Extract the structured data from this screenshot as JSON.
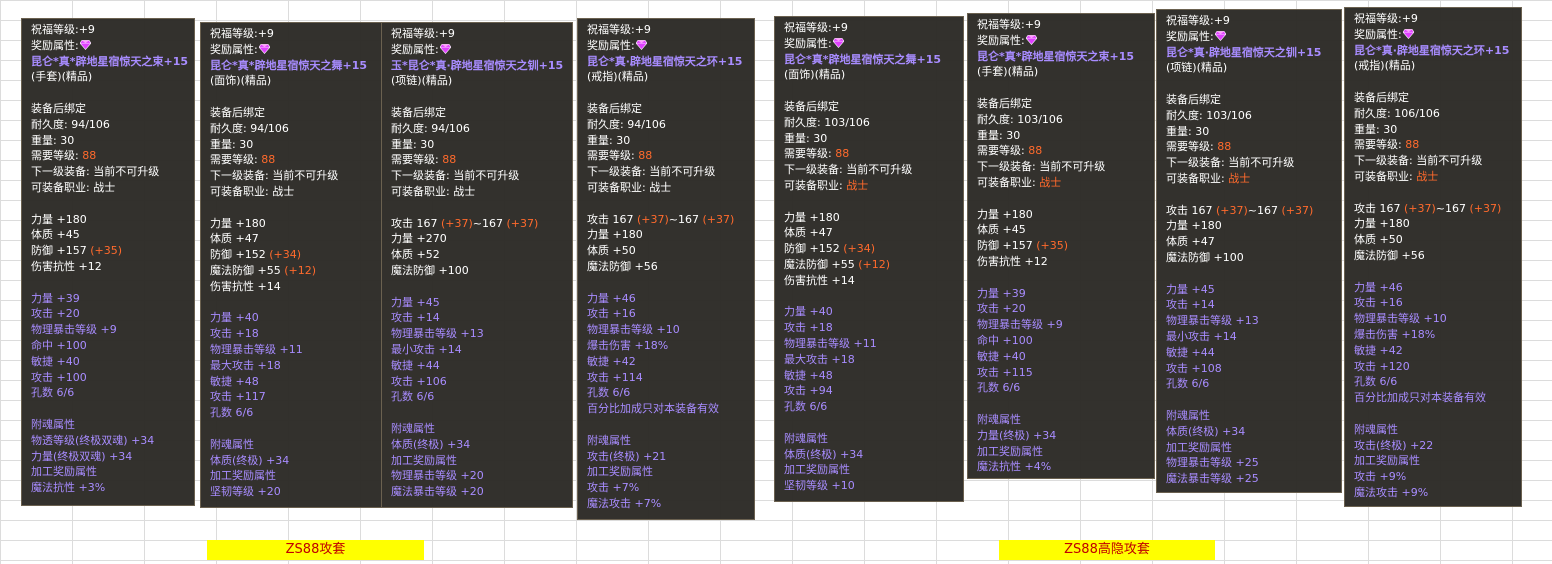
{
  "colors": {
    "tooltip_bg": "#282622",
    "purple_text": "#a88cff",
    "orange_text": "#ff6a2c",
    "banner_bg": "#ffff00",
    "banner_text": "#c00000"
  },
  "banners": {
    "left": "ZS88攻套",
    "right": "ZS88高隐攻套"
  },
  "tooltips": [
    {
      "lines": [
        {
          "t": "祝福等级:+9"
        },
        {
          "t": "奖励属性:",
          "gem": true
        },
        {
          "t": "昆仑*真*辟地星宿惊天之束+15",
          "c": "title"
        },
        {
          "t": "(手套)(精品)"
        },
        {
          "gap": true
        },
        {
          "t": "装备后绑定"
        },
        {
          "t": "耐久度: 94/106"
        },
        {
          "t": "重量: 30"
        },
        {
          "t": "需要等级: ",
          "v": "88",
          "vc": "orange"
        },
        {
          "t": "下一级装备: 当前不可升级"
        },
        {
          "t": "可装备职业: 战士"
        },
        {
          "gap": true
        },
        {
          "t": "力量 +180"
        },
        {
          "t": "体质 +45"
        },
        {
          "t": "防御 +157 ",
          "v": "(+35)",
          "vc": "orange"
        },
        {
          "t": "伤害抗性 +12"
        },
        {
          "gap": true
        },
        {
          "t": "力量 +39",
          "c": "purple"
        },
        {
          "t": "攻击 +20",
          "c": "purple"
        },
        {
          "t": "物理暴击等级 +9",
          "c": "purple"
        },
        {
          "t": "命中 +100",
          "c": "purple"
        },
        {
          "t": "敏捷 +40",
          "c": "purple"
        },
        {
          "t": "攻击 +100",
          "c": "purple"
        },
        {
          "t": "孔数 6/6",
          "c": "purple"
        },
        {
          "gap": true
        },
        {
          "t": "附魂属性",
          "c": "purple"
        },
        {
          "t": "物透等级(终极双魂) +34",
          "c": "purple"
        },
        {
          "t": "力量(终极双魂) +34",
          "c": "purple"
        },
        {
          "t": "加工奖励属性",
          "c": "purple"
        },
        {
          "t": "魔法抗性 +3%",
          "c": "purple"
        }
      ]
    },
    {
      "lines": [
        {
          "t": "祝福等级:+9"
        },
        {
          "t": "奖励属性:",
          "gem": true
        },
        {
          "t": "昆仑*真*辟地星宿惊天之舞+15",
          "c": "title"
        },
        {
          "t": "(面饰)(精品)"
        },
        {
          "gap": true
        },
        {
          "t": "装备后绑定"
        },
        {
          "t": "耐久度: 94/106"
        },
        {
          "t": "重量: 30"
        },
        {
          "t": "需要等级: ",
          "v": "88",
          "vc": "orange"
        },
        {
          "t": "下一级装备: 当前不可升级"
        },
        {
          "t": "可装备职业: 战士"
        },
        {
          "gap": true
        },
        {
          "t": "力量 +180"
        },
        {
          "t": "体质 +47"
        },
        {
          "t": "防御 +152 ",
          "v": "(+34)",
          "vc": "orange"
        },
        {
          "t": "魔法防御 +55 ",
          "v": "(+12)",
          "vc": "orange"
        },
        {
          "t": "伤害抗性 +14"
        },
        {
          "gap": true
        },
        {
          "t": "力量 +40",
          "c": "purple"
        },
        {
          "t": "攻击 +18",
          "c": "purple"
        },
        {
          "t": "物理暴击等级 +11",
          "c": "purple"
        },
        {
          "t": "最大攻击 +18",
          "c": "purple"
        },
        {
          "t": "敏捷 +48",
          "c": "purple"
        },
        {
          "t": "攻击 +117",
          "c": "purple"
        },
        {
          "t": "孔数 6/6",
          "c": "purple"
        },
        {
          "gap": true
        },
        {
          "t": "附魂属性",
          "c": "purple"
        },
        {
          "t": "体质(终极) +34",
          "c": "purple"
        },
        {
          "t": "加工奖励属性",
          "c": "purple"
        },
        {
          "t": "坚韧等级 +20",
          "c": "purple"
        }
      ]
    },
    {
      "lines": [
        {
          "t": "祝福等级:+9"
        },
        {
          "t": "奖励属性:",
          "gem": true
        },
        {
          "t": "玉*昆仑*真·辟地星宿惊天之钏+15",
          "c": "title"
        },
        {
          "t": "(项链)(精品)"
        },
        {
          "gap": true
        },
        {
          "t": "装备后绑定"
        },
        {
          "t": "耐久度: 94/106"
        },
        {
          "t": "重量: 30"
        },
        {
          "t": "需要等级: ",
          "v": "88",
          "vc": "orange"
        },
        {
          "t": "下一级装备: 当前不可升级"
        },
        {
          "t": "可装备职业: 战士"
        },
        {
          "gap": true
        },
        {
          "t": "攻击 167 ",
          "v": "(+37)",
          "vc": "orange",
          "t2": "~167 ",
          "v2": "(+37)"
        },
        {
          "t": "力量 +270"
        },
        {
          "t": "体质 +52"
        },
        {
          "t": "魔法防御 +100"
        },
        {
          "gap": true
        },
        {
          "t": "力量 +45",
          "c": "purple"
        },
        {
          "t": "攻击 +14",
          "c": "purple"
        },
        {
          "t": "物理暴击等级 +13",
          "c": "purple"
        },
        {
          "t": "最小攻击 +14",
          "c": "purple"
        },
        {
          "t": "敏捷 +44",
          "c": "purple"
        },
        {
          "t": "攻击 +106",
          "c": "purple"
        },
        {
          "t": "孔数 6/6",
          "c": "purple"
        },
        {
          "gap": true
        },
        {
          "t": "附魂属性",
          "c": "purple"
        },
        {
          "t": "体质(终极) +34",
          "c": "purple"
        },
        {
          "t": "加工奖励属性",
          "c": "purple"
        },
        {
          "t": "物理暴击等级 +20",
          "c": "purple"
        },
        {
          "t": "魔法暴击等级 +20",
          "c": "purple"
        }
      ]
    },
    {
      "lines": [
        {
          "t": "祝福等级:+9"
        },
        {
          "t": "奖励属性:",
          "gem": true
        },
        {
          "t": "昆仑*真·辟地星宿惊天之环+15",
          "c": "title"
        },
        {
          "t": "(戒指)(精品)"
        },
        {
          "gap": true
        },
        {
          "t": "装备后绑定"
        },
        {
          "t": "耐久度: 94/106"
        },
        {
          "t": "重量: 30"
        },
        {
          "t": "需要等级: ",
          "v": "88",
          "vc": "orange"
        },
        {
          "t": "下一级装备: 当前不可升级"
        },
        {
          "t": "可装备职业: 战士"
        },
        {
          "gap": true
        },
        {
          "t": "攻击 167 ",
          "v": "(+37)",
          "vc": "orange",
          "t2": "~167 ",
          "v2": "(+37)"
        },
        {
          "t": "力量 +180"
        },
        {
          "t": "体质 +50"
        },
        {
          "t": "魔法防御 +56"
        },
        {
          "gap": true
        },
        {
          "t": "力量 +46",
          "c": "purple"
        },
        {
          "t": "攻击 +16",
          "c": "purple"
        },
        {
          "t": "物理暴击等级 +10",
          "c": "purple"
        },
        {
          "t": "爆击伤害 +18%",
          "c": "purple"
        },
        {
          "t": "敏捷 +42",
          "c": "purple"
        },
        {
          "t": "攻击 +114",
          "c": "purple"
        },
        {
          "t": "孔数 6/6",
          "c": "purple"
        },
        {
          "t": "百分比加成只对本装备有效",
          "c": "purple"
        },
        {
          "gap": true
        },
        {
          "t": "附魂属性",
          "c": "purple"
        },
        {
          "t": "攻击(终极) +21",
          "c": "purple"
        },
        {
          "t": "加工奖励属性",
          "c": "purple"
        },
        {
          "t": "攻击 +7%",
          "c": "purple"
        },
        {
          "t": "魔法攻击 +7%",
          "c": "purple"
        }
      ]
    },
    {
      "lines": [
        {
          "t": "祝福等级:+9"
        },
        {
          "t": "奖励属性:",
          "gem": true
        },
        {
          "t": "昆仑*真*辟地星宿惊天之舞+15",
          "c": "title"
        },
        {
          "t": "(面饰)(精品)"
        },
        {
          "gap": true
        },
        {
          "t": "装备后绑定"
        },
        {
          "t": "耐久度: 103/106"
        },
        {
          "t": "重量: 30"
        },
        {
          "t": "需要等级: ",
          "v": "88",
          "vc": "orange"
        },
        {
          "t": "下一级装备: 当前不可升级"
        },
        {
          "t": "可装备职业: ",
          "v": "战士",
          "vc": "orange"
        },
        {
          "gap": true
        },
        {
          "t": "力量 +180"
        },
        {
          "t": "体质 +47"
        },
        {
          "t": "防御 +152 ",
          "v": "(+34)",
          "vc": "orange"
        },
        {
          "t": "魔法防御 +55 ",
          "v": "(+12)",
          "vc": "orange"
        },
        {
          "t": "伤害抗性 +14"
        },
        {
          "gap": true
        },
        {
          "t": "力量 +40",
          "c": "purple"
        },
        {
          "t": "攻击 +18",
          "c": "purple"
        },
        {
          "t": "物理暴击等级 +11",
          "c": "purple"
        },
        {
          "t": "最大攻击 +18",
          "c": "purple"
        },
        {
          "t": "敏捷 +48",
          "c": "purple"
        },
        {
          "t": "攻击 +94",
          "c": "purple"
        },
        {
          "t": "孔数 6/6",
          "c": "purple"
        },
        {
          "gap": true
        },
        {
          "t": "附魂属性",
          "c": "purple"
        },
        {
          "t": "体质(终极) +34",
          "c": "purple"
        },
        {
          "t": "加工奖励属性",
          "c": "purple"
        },
        {
          "t": "坚韧等级 +10",
          "c": "purple"
        }
      ]
    },
    {
      "lines": [
        {
          "t": "祝福等级:+9"
        },
        {
          "t": "奖励属性:",
          "gem": true
        },
        {
          "t": "昆仑*真*辟地星宿惊天之束+15",
          "c": "title"
        },
        {
          "t": "(手套)(精品)"
        },
        {
          "gap": true
        },
        {
          "t": "装备后绑定"
        },
        {
          "t": "耐久度: 103/106"
        },
        {
          "t": "重量: 30"
        },
        {
          "t": "需要等级: ",
          "v": "88",
          "vc": "orange"
        },
        {
          "t": "下一级装备: 当前不可升级"
        },
        {
          "t": "可装备职业: ",
          "v": "战士",
          "vc": "orange"
        },
        {
          "gap": true
        },
        {
          "t": "力量 +180"
        },
        {
          "t": "体质 +45"
        },
        {
          "t": "防御 +157 ",
          "v": "(+35)",
          "vc": "orange"
        },
        {
          "t": "伤害抗性 +12"
        },
        {
          "gap": true
        },
        {
          "t": "力量 +39",
          "c": "purple"
        },
        {
          "t": "攻击 +20",
          "c": "purple"
        },
        {
          "t": "物理暴击等级 +9",
          "c": "purple"
        },
        {
          "t": "命中 +100",
          "c": "purple"
        },
        {
          "t": "敏捷 +40",
          "c": "purple"
        },
        {
          "t": "攻击 +115",
          "c": "purple"
        },
        {
          "t": "孔数 6/6",
          "c": "purple"
        },
        {
          "gap": true
        },
        {
          "t": "附魂属性",
          "c": "purple"
        },
        {
          "t": "力量(终极) +34",
          "c": "purple"
        },
        {
          "t": "加工奖励属性",
          "c": "purple"
        },
        {
          "t": "魔法抗性 +4%",
          "c": "purple"
        }
      ]
    },
    {
      "lines": [
        {
          "t": "祝福等级:+9"
        },
        {
          "t": "奖励属性:",
          "gem": true
        },
        {
          "t": "昆仑*真·辟地星宿惊天之钏+15",
          "c": "title"
        },
        {
          "t": "(项链)(精品)"
        },
        {
          "gap": true
        },
        {
          "t": "装备后绑定"
        },
        {
          "t": "耐久度: 103/106"
        },
        {
          "t": "重量: 30"
        },
        {
          "t": "需要等级: ",
          "v": "88",
          "vc": "orange"
        },
        {
          "t": "下一级装备: 当前不可升级"
        },
        {
          "t": "可装备职业: ",
          "v": "战士",
          "vc": "orange"
        },
        {
          "gap": true
        },
        {
          "t": "攻击 167 ",
          "v": "(+37)",
          "vc": "orange",
          "t2": "~167 ",
          "v2": "(+37)"
        },
        {
          "t": "力量 +180"
        },
        {
          "t": "体质 +47"
        },
        {
          "t": "魔法防御 +100"
        },
        {
          "gap": true
        },
        {
          "t": "力量 +45",
          "c": "purple"
        },
        {
          "t": "攻击 +14",
          "c": "purple"
        },
        {
          "t": "物理暴击等级 +13",
          "c": "purple"
        },
        {
          "t": "最小攻击 +14",
          "c": "purple"
        },
        {
          "t": "敏捷 +44",
          "c": "purple"
        },
        {
          "t": "攻击 +108",
          "c": "purple"
        },
        {
          "t": "孔数 6/6",
          "c": "purple"
        },
        {
          "gap": true
        },
        {
          "t": "附魂属性",
          "c": "purple"
        },
        {
          "t": "体质(终极) +34",
          "c": "purple"
        },
        {
          "t": "加工奖励属性",
          "c": "purple"
        },
        {
          "t": "物理暴击等级 +25",
          "c": "purple"
        },
        {
          "t": "魔法暴击等级 +25",
          "c": "purple"
        }
      ]
    },
    {
      "lines": [
        {
          "t": "祝福等级:+9"
        },
        {
          "t": "奖励属性:",
          "gem": true
        },
        {
          "t": "昆仑*真·辟地星宿惊天之环+15",
          "c": "title"
        },
        {
          "t": "(戒指)(精品)"
        },
        {
          "gap": true
        },
        {
          "t": "装备后绑定"
        },
        {
          "t": "耐久度: 106/106"
        },
        {
          "t": "重量: 30"
        },
        {
          "t": "需要等级: ",
          "v": "88",
          "vc": "orange"
        },
        {
          "t": "下一级装备: 当前不可升级"
        },
        {
          "t": "可装备职业: ",
          "v": "战士",
          "vc": "orange"
        },
        {
          "gap": true
        },
        {
          "t": "攻击 167 ",
          "v": "(+37)",
          "vc": "orange",
          "t2": "~167 ",
          "v2": "(+37)"
        },
        {
          "t": "力量 +180"
        },
        {
          "t": "体质 +50"
        },
        {
          "t": "魔法防御 +56"
        },
        {
          "gap": true
        },
        {
          "t": "力量 +46",
          "c": "purple"
        },
        {
          "t": "攻击 +16",
          "c": "purple"
        },
        {
          "t": "物理暴击等级 +10",
          "c": "purple"
        },
        {
          "t": "爆击伤害 +18%",
          "c": "purple"
        },
        {
          "t": "敏捷 +42",
          "c": "purple"
        },
        {
          "t": "攻击 +120",
          "c": "purple"
        },
        {
          "t": "孔数 6/6",
          "c": "purple"
        },
        {
          "t": "百分比加成只对本装备有效",
          "c": "purple"
        },
        {
          "gap": true
        },
        {
          "t": "附魂属性",
          "c": "purple"
        },
        {
          "t": "攻击(终极) +22",
          "c": "purple"
        },
        {
          "t": "加工奖励属性",
          "c": "purple"
        },
        {
          "t": "攻击 +9%",
          "c": "purple"
        },
        {
          "t": "魔法攻击 +9%",
          "c": "purple"
        }
      ]
    }
  ]
}
